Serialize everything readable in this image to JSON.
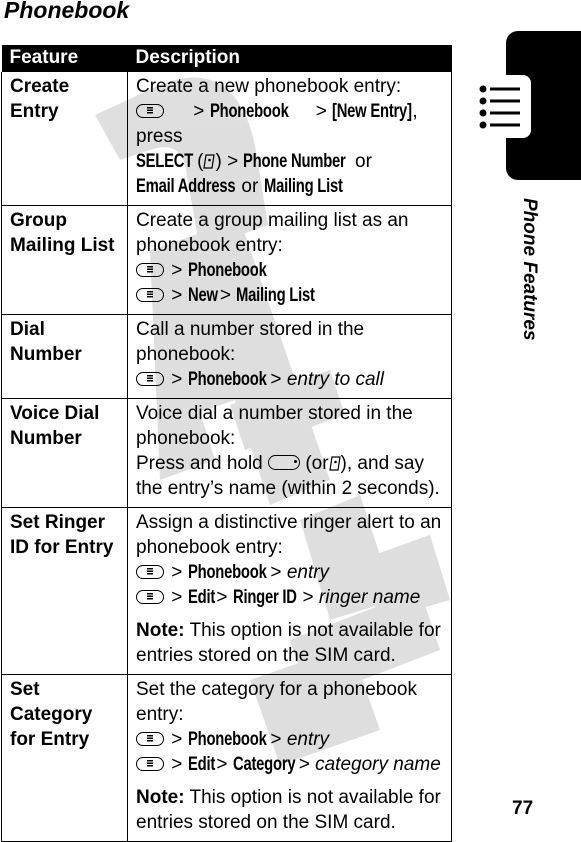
{
  "page": {
    "title": "Phonebook",
    "section_tab_label": "Phone Features",
    "section_tab_icon": "list-icon",
    "page_number": "77",
    "watermark_text": "DRAFT"
  },
  "table": {
    "headers": {
      "feature": "Feature",
      "description": "Description"
    },
    "rows": [
      {
        "feature": "Create Entry",
        "intro": "Create a new phonebook entry:",
        "line1": {
          "sep1": ">",
          "cmd1": "Phonebook",
          "sep2": ">",
          "cmd2": "[New Entry]",
          "text": ", press"
        },
        "line2": {
          "cmd1": "SELECT",
          "paren_open": "(",
          "paren_close": ")",
          "sep": ">",
          "cmd2": "Phone Number",
          "or": "or"
        },
        "line3": {
          "cmd1": "Email Address",
          "or": "or",
          "cmd2": "Mailing List"
        }
      },
      {
        "feature": "Group Mailing List",
        "intro": "Create a group mailing list as an phonebook entry:",
        "path1": {
          "sep1": ">",
          "cmd1": "Phonebook"
        },
        "path2": {
          "sep1": ">",
          "cmd1": "New",
          "sep2": ">",
          "cmd2": "Mailing List"
        }
      },
      {
        "feature": "Dial Number",
        "intro": "Call a number stored in the phonebook:",
        "path1": {
          "sep1": ">",
          "cmd1": "Phonebook",
          "sep2": ">",
          "item": "entry to call"
        }
      },
      {
        "feature": "Voice Dial Number",
        "intro": "Voice dial a number stored in the phonebook:",
        "instr_a": "Press and hold",
        "instr_b": "(or",
        "instr_c": "), and say the entry’s name (within 2 seconds)."
      },
      {
        "feature": "Set Ringer ID for Entry",
        "intro": "Assign a distinctive ringer alert to an phonebook entry:",
        "path1": {
          "sep1": ">",
          "cmd1": "Phonebook",
          "sep2": ">",
          "item": "entry"
        },
        "path2": {
          "sep1": ">",
          "cmd1": "Edit",
          "sep2": ">",
          "cmd2": "Ringer ID",
          "sep3": ">",
          "item": "ringer name"
        },
        "note_label": "Note:",
        "note_text": " This option is not available for entries stored on the SIM card."
      },
      {
        "feature": "Set Category for Entry",
        "intro": "Set the category for a phonebook entry:",
        "path1": {
          "sep1": ">",
          "cmd1": "Phonebook",
          "sep2": ">",
          "item": "entry"
        },
        "path2": {
          "sep1": ">",
          "cmd1": "Edit",
          "sep2": ">",
          "cmd2": "Category",
          "sep3": ">",
          "item": "category name"
        },
        "note_label": "Note:",
        "note_text": " This option is not available for entries stored on the SIM card."
      }
    ]
  }
}
